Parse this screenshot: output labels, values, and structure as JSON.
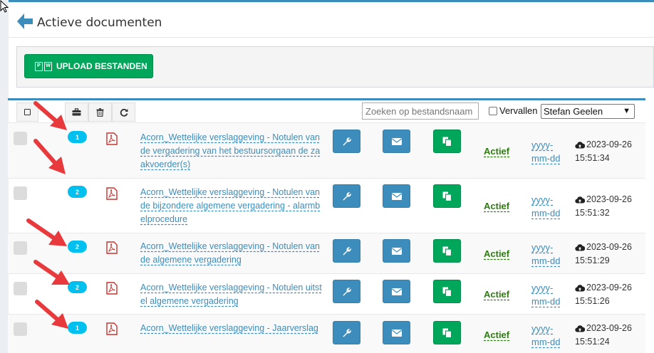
{
  "header": {
    "title": "Actieve documenten"
  },
  "upload": {
    "label": "UPLOAD BESTANDEN",
    "icons": [
      "pdf-icon",
      "word-icon"
    ]
  },
  "toolbar": {
    "search_placeholder": "Zoeken op bestandsnaam",
    "expired_label": "Vervallen",
    "user_selected": "Stefan Geelen"
  },
  "colors": {
    "primary": "#3c8dbc",
    "success": "#00a65a",
    "badge": "#00c0ef",
    "status": "#2e7d12"
  },
  "rows": [
    {
      "badge": "1",
      "name": "Acorn_Wettelijke verslaggeving - Notulen van de vergadering van het bestuursorgaan de zaakvoerder(s)",
      "status": "Actief",
      "expiry": "yyyy-mm-dd",
      "date": "2023-09-26",
      "time": "15:51:34"
    },
    {
      "badge": "2",
      "name": "Acorn_Wettelijke verslaggeving - Notulen van de bijzondere algemene vergadering - alarmbelprocedure",
      "status": "Actief",
      "expiry": "yyyy-mm-dd",
      "date": "2023-09-26",
      "time": "15:51:32"
    },
    {
      "badge": "2",
      "name": "Acorn_Wettelijke verslaggeving - Notulen van de algemene vergadering",
      "status": "Actief",
      "expiry": "yyyy-mm-dd",
      "date": "2023-09-26",
      "time": "15:51:29"
    },
    {
      "badge": "2",
      "name": "Acorn_Wettelijke verslaggeving - Notulen uitstel algemene vergadering",
      "status": "Actief",
      "expiry": "yyyy-mm-dd",
      "date": "2023-09-26",
      "time": "15:51:26"
    },
    {
      "badge": "1",
      "name": "Acorn_Wettelijke verslaggeving - Jaarverslag",
      "status": "Actief",
      "expiry": "yyyy-mm-dd",
      "date": "2023-09-26",
      "time": "15:51:24"
    }
  ]
}
